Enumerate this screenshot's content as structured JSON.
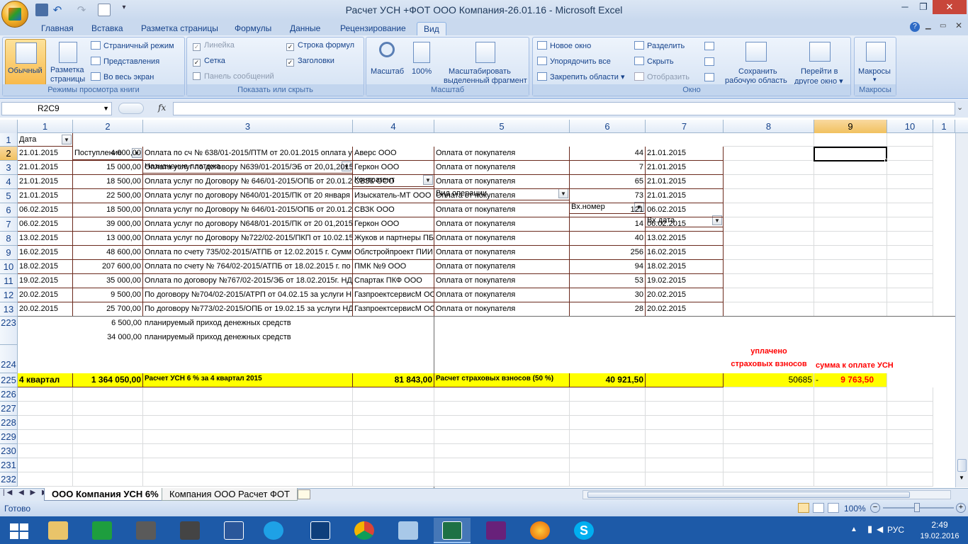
{
  "window": {
    "title": "Расчет УСН +ФОТ ООО Компания-26.01.16 - Microsoft Excel",
    "buttons": {
      "minimize": "─",
      "restore": "❐",
      "close": "✕"
    }
  },
  "tabs": [
    "Главная",
    "Вставка",
    "Разметка страницы",
    "Формулы",
    "Данные",
    "Рецензирование",
    "Вид"
  ],
  "ribbon": {
    "views": {
      "normal": "Обычный",
      "page_layout_1": "Разметка",
      "page_layout_2": "страницы",
      "page_mode": "Страничный режим",
      "custom_views": "Представления",
      "full_screen": "Во весь экран",
      "caption": "Режимы просмотра книги"
    },
    "show": {
      "ruler": "Линейка",
      "gridlines": "Сетка",
      "message_bar": "Панель сообщений",
      "formula_bar": "Строка формул",
      "headings": "Заголовки",
      "caption": "Показать или скрыть"
    },
    "zoom": {
      "zoom": "Масштаб",
      "hundred": "100%",
      "zoom_sel_1": "Масштабировать",
      "zoom_sel_2": "выделенный фрагмент",
      "caption": "Масштаб"
    },
    "window": {
      "new_window": "Новое окно",
      "arrange_all": "Упорядочить все",
      "freeze": "Закрепить области",
      "split": "Разделить",
      "hide": "Скрыть",
      "unhide": "Отобразить",
      "save_ws_1": "Сохранить",
      "save_ws_2": "рабочую область",
      "switch_1": "Перейти в",
      "switch_2": "другое окно",
      "caption": "Окно"
    },
    "macros": {
      "macros": "Макросы",
      "caption": "Макросы"
    }
  },
  "formula_bar": {
    "name_box": "R2C9",
    "fx": "fx",
    "value": ""
  },
  "columns": [
    "1",
    "2",
    "3",
    "4",
    "5",
    "6",
    "7",
    "8",
    "9",
    "10",
    "1"
  ],
  "header_row": {
    "row": "1",
    "cells": [
      "Дата",
      "Поступление",
      "Назначение платежа",
      "Контрагент",
      "Вид операции",
      "Вх.номер",
      "Вх.дата"
    ]
  },
  "rows": [
    {
      "row": "2",
      "date": "21.01.2015",
      "amount": "4 000,00",
      "purpose": "Оплата по сч № 638/01-2015/ПТМ от 20.01.2015 оплата у",
      "counterparty": "Аверс ООО",
      "op": "Оплата от покупателя",
      "num": "44",
      "in_date": "21.01.2015"
    },
    {
      "row": "3",
      "date": "21.01.2015",
      "amount": "15 000,00",
      "purpose": "Оплата услуг по договору N639/01-2015/ЭБ от 20,01,2015",
      "counterparty": "Геркон ООО",
      "op": "Оплата от покупателя",
      "num": "7",
      "in_date": "21.01.2015"
    },
    {
      "row": "4",
      "date": "21.01.2015",
      "amount": "18 500,00",
      "purpose": "Оплата услуг по Договору № 646/01-2015/ОПБ от 20.01.2",
      "counterparty": "СВЗК ООО",
      "op": "Оплата от покупателя",
      "num": "65",
      "in_date": "21.01.2015"
    },
    {
      "row": "5",
      "date": "21.01.2015",
      "amount": "22 500,00",
      "purpose": "Оплата услуг по договору N640/01-2015/ПК от 20 января",
      "counterparty": "Изыскатель-МТ ООО",
      "op": "Оплата от покупателя",
      "num": "73",
      "in_date": "21.01.2015"
    },
    {
      "row": "6",
      "date": "06.02.2015",
      "amount": "18 500,00",
      "purpose": "Оплата услуг по Договору № 646/01-2015/ОПБ от 20.01.2",
      "counterparty": "СВЗК ООО",
      "op": "Оплата от покупателя",
      "num": "121",
      "in_date": "06.02.2015"
    },
    {
      "row": "7",
      "date": "06.02.2015",
      "amount": "39 000,00",
      "purpose": "Оплата услуг по договору N648/01-2015/ПК от 20 01,2015",
      "counterparty": "Геркон ООО",
      "op": "Оплата от покупателя",
      "num": "14",
      "in_date": "06.02.2015"
    },
    {
      "row": "8",
      "date": "13.02.2015",
      "amount": "13 000,00",
      "purpose": "Оплата услуг по Договору №722/02-2015/ПКП от 10.02.15",
      "counterparty": "Жуков и партнеры ПБ",
      "op": "Оплата от покупателя",
      "num": "40",
      "in_date": "13.02.2015"
    },
    {
      "row": "9",
      "date": "16.02.2015",
      "amount": "48 600,00",
      "purpose": "Оплата по счету 735/02-2015/АТПБ от 12.02.2015 г. Сумм",
      "counterparty": "Облстройпроект ПИИ",
      "op": "Оплата от покупателя",
      "num": "256",
      "in_date": "16.02.2015"
    },
    {
      "row": "10",
      "date": "18.02.2015",
      "amount": "207 600,00",
      "purpose": "Оплата по счету № 764/02-2015/АТПБ от 18.02.2015 г. по",
      "counterparty": "ПМК №9 ООО",
      "op": "Оплата от покупателя",
      "num": "94",
      "in_date": "18.02.2015"
    },
    {
      "row": "11",
      "date": "19.02.2015",
      "amount": "35 000,00",
      "purpose": "Оплата по договору №767/02-2015/ЭБ от 18.02.2015г. НД",
      "counterparty": "Спартак ПКФ ООО",
      "op": "Оплата от покупателя",
      "num": "53",
      "in_date": "19.02.2015"
    },
    {
      "row": "12",
      "date": "20.02.2015",
      "amount": "9 500,00",
      "purpose": "По договору №704/02-2015/АТРП от 04.02.15 за услуги Н,",
      "counterparty": "ГазпроектсервисМ ОО",
      "op": "Оплата от покупателя",
      "num": "30",
      "in_date": "20.02.2015"
    },
    {
      "row": "13",
      "date": "20.02.2015",
      "amount": "25 700,00",
      "purpose": "По договору №773/02-2015/ОПБ от 19.02.15 за услуги НД",
      "counterparty": "ГазпроектсервисМ ОО",
      "op": "Оплата от покупателя",
      "num": "28",
      "in_date": "20.02.2015"
    }
  ],
  "planned": [
    {
      "row": "223",
      "amount": "6 500,00",
      "text": "планируемый приход денежных средств"
    },
    {
      "row": "",
      "amount": "34 000,00",
      "text": "планируемый приход денежных средств"
    }
  ],
  "row224": {
    "row": "224",
    "paid_1": "уплачено",
    "paid_2": "страховых взносов",
    "due": "сумма к оплате УСН"
  },
  "row225": {
    "row": "225",
    "quarter": "4 квартал",
    "total": "1 364 050,00",
    "usn_label": "Расчет УСН 6 % за 4 квартал 2015",
    "usn": "81 843,00",
    "ins_label": "Расчет страховых взносов (50 %)",
    "ins": "40 921,50",
    "paid": "50685",
    "dash": "-",
    "due": "9 763,50"
  },
  "empty_rows": [
    "226",
    "227",
    "228",
    "229",
    "230",
    "231",
    "232"
  ],
  "sheets": {
    "active": "ООО Компания УСН 6%",
    "other": "Компания ООО Расчет ФОТ"
  },
  "status": {
    "ready": "Готово",
    "zoom": "100%"
  },
  "taskbar": {
    "lang": "РУС",
    "time": "2:49",
    "date": "19.02.2016"
  }
}
